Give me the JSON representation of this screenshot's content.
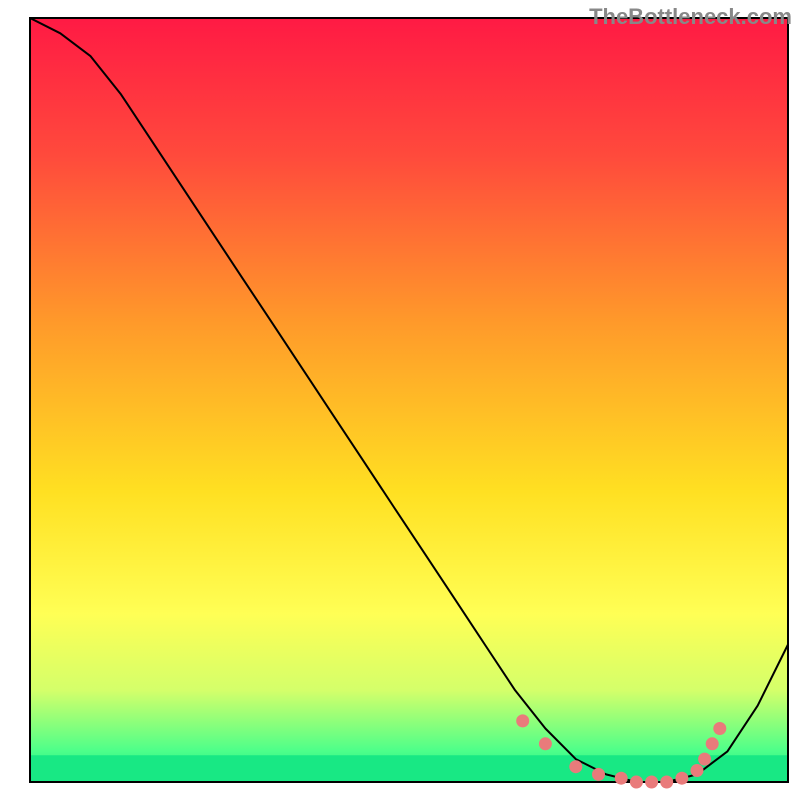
{
  "watermark": "TheBottleneck.com",
  "chart_data": {
    "type": "line",
    "title": "",
    "xlabel": "",
    "ylabel": "",
    "xlim": [
      0,
      100
    ],
    "ylim": [
      0,
      100
    ],
    "background": {
      "gradient": [
        {
          "stop": 0,
          "color": "#ff1a44"
        },
        {
          "stop": 0.18,
          "color": "#ff4a3c"
        },
        {
          "stop": 0.4,
          "color": "#ff9a2a"
        },
        {
          "stop": 0.62,
          "color": "#ffe022"
        },
        {
          "stop": 0.78,
          "color": "#ffff55"
        },
        {
          "stop": 0.88,
          "color": "#d4ff6a"
        },
        {
          "stop": 0.96,
          "color": "#4cff8a"
        },
        {
          "stop": 1.0,
          "color": "#18e884"
        }
      ],
      "band_y": 0.965,
      "band_color": "#18e884"
    },
    "series": [
      {
        "name": "curve",
        "color": "#000000",
        "width": 2,
        "x": [
          0,
          4,
          8,
          12,
          16,
          20,
          24,
          28,
          32,
          36,
          40,
          44,
          48,
          52,
          56,
          60,
          64,
          68,
          72,
          76,
          80,
          84,
          88,
          92,
          96,
          100
        ],
        "y": [
          100,
          98,
          95,
          90,
          84,
          78,
          72,
          66,
          60,
          54,
          48,
          42,
          36,
          30,
          24,
          18,
          12,
          7,
          3,
          1,
          0,
          0,
          1,
          4,
          10,
          18
        ]
      }
    ],
    "markers": {
      "name": "dots",
      "color": "#e97b7b",
      "radius": 6.5,
      "points": [
        {
          "x": 65,
          "y": 8
        },
        {
          "x": 68,
          "y": 5
        },
        {
          "x": 72,
          "y": 2
        },
        {
          "x": 75,
          "y": 1
        },
        {
          "x": 78,
          "y": 0.5
        },
        {
          "x": 80,
          "y": 0
        },
        {
          "x": 82,
          "y": 0
        },
        {
          "x": 84,
          "y": 0
        },
        {
          "x": 86,
          "y": 0.5
        },
        {
          "x": 88,
          "y": 1.5
        },
        {
          "x": 89,
          "y": 3
        },
        {
          "x": 90,
          "y": 5
        },
        {
          "x": 91,
          "y": 7
        }
      ]
    }
  }
}
